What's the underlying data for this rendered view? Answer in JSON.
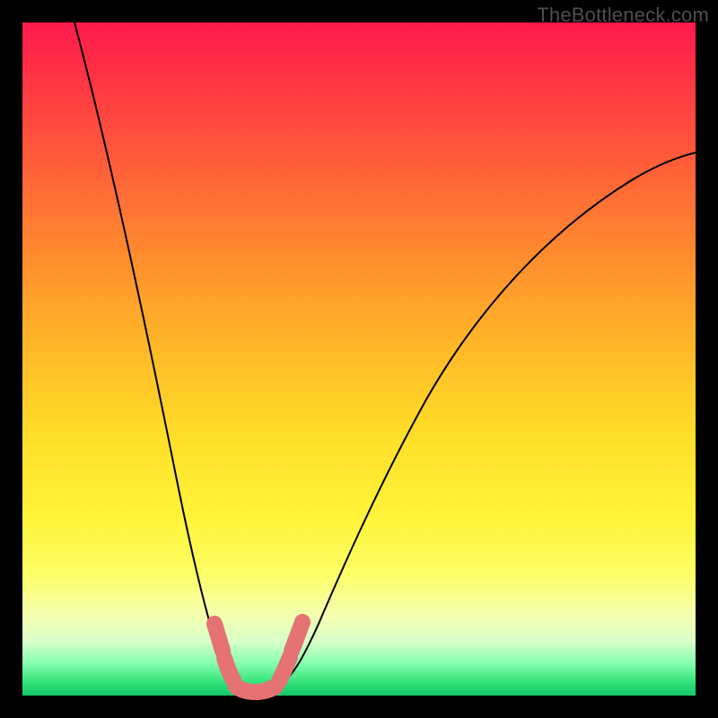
{
  "watermark": "TheBottleneck.com",
  "colors": {
    "background": "#000000",
    "curve": "#000000",
    "accent_segment": "#e57373",
    "gradient_top": "#ff1a4d",
    "gradient_bottom": "#12c866"
  },
  "chart_data": {
    "type": "line",
    "title": "",
    "xlabel": "",
    "ylabel": "",
    "xlim": [
      0,
      100
    ],
    "ylim": [
      0,
      100
    ],
    "grid": false,
    "legend": false,
    "series": [
      {
        "name": "bottleneck-curve",
        "x": [
          0,
          4,
          8,
          12,
          16,
          20,
          22,
          24,
          26,
          28,
          30,
          32,
          36,
          40,
          46,
          54,
          62,
          70,
          80,
          90,
          100
        ],
        "y": [
          100,
          88,
          75,
          62,
          48,
          32,
          24,
          14,
          6,
          2,
          0,
          0,
          2,
          8,
          18,
          30,
          42,
          52,
          62,
          70,
          75
        ]
      }
    ],
    "annotations": [
      {
        "name": "accent-trough",
        "x": [
          24,
          26,
          28,
          30,
          32,
          34,
          36
        ],
        "y": [
          14,
          6,
          2,
          0,
          0,
          2,
          8
        ],
        "color": "#e57373"
      }
    ]
  }
}
